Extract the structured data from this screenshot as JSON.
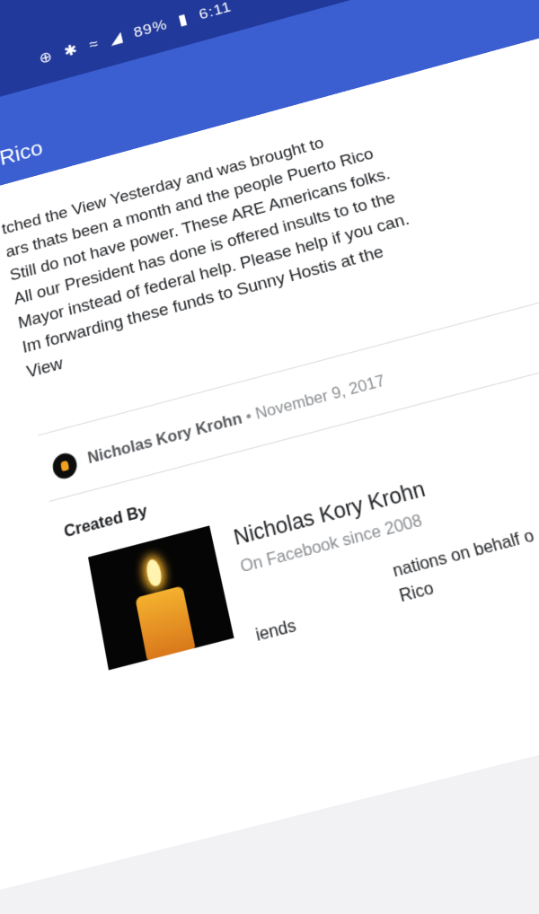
{
  "status_bar": {
    "icons": [
      "data-saver-icon",
      "bluetooth-icon",
      "wifi-icon",
      "signal-icon"
    ],
    "battery": "89%",
    "time": "6:11"
  },
  "app_bar": {
    "title": "o Rico"
  },
  "fundraiser": {
    "description": "tched the View Yesterday and was brought to\nars thats been a month and the people Puerto Rico\nStill do not have power.  These ARE Americans folks.\nAll  our President has done is offered insults to to the\nMayor instead of federal help. Please help if you can.\nIm forwarding these funds to Sunny Hostis at the\nView",
    "author": "Nicholas Kory Krohn",
    "date": "November 9, 2017",
    "separator": "•"
  },
  "created_by": {
    "label": "Created By",
    "name": "Nicholas Kory Krohn",
    "since": "On Facebook since 2008",
    "note": "nations on behalf o\nRico",
    "friends": "iends"
  },
  "colors": {
    "status_bar": "#20399a",
    "app_bar": "#3b5ed1",
    "card": "#ffffff",
    "text": "#1d1f22",
    "muted": "#8a8d91"
  }
}
